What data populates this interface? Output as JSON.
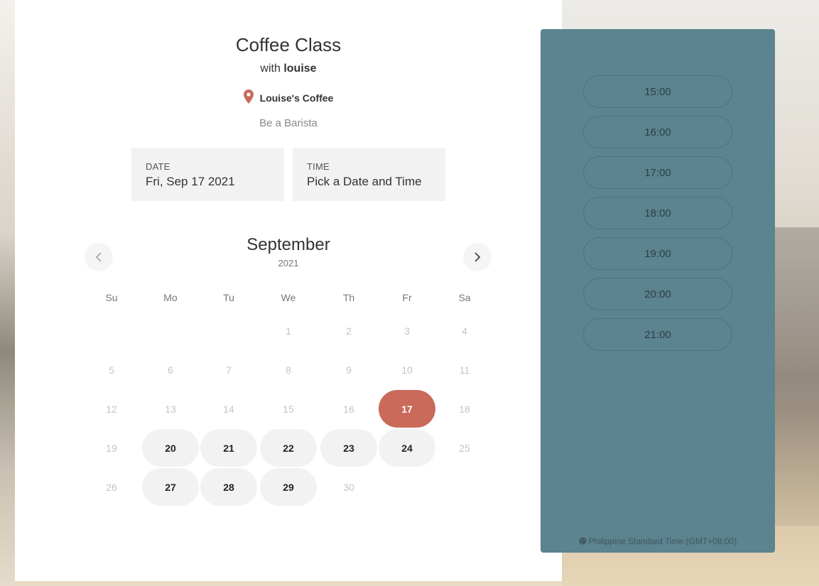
{
  "event": {
    "title": "Coffee Class",
    "with_prefix": "with",
    "host": "louise",
    "location": "Louise's Coffee",
    "description": "Be a Barista"
  },
  "fields": {
    "date_label": "DATE",
    "date_value": "Fri, Sep 17 2021",
    "time_label": "TIME",
    "time_value": "Pick a Date and Time"
  },
  "calendar": {
    "month": "September",
    "year": "2021",
    "weekdays": [
      "Su",
      "Mo",
      "Tu",
      "We",
      "Th",
      "Fr",
      "Sa"
    ],
    "weeks": [
      [
        null,
        null,
        null,
        "1",
        "2",
        "3",
        "4"
      ],
      [
        "5",
        "6",
        "7",
        "8",
        "9",
        "10",
        "11"
      ],
      [
        "12",
        "13",
        "14",
        "15",
        "16",
        "17",
        "18"
      ],
      [
        "19",
        "20",
        "21",
        "22",
        "23",
        "24",
        "25"
      ],
      [
        "26",
        "27",
        "28",
        "29",
        "30",
        null,
        null
      ]
    ],
    "available_days": [
      "20",
      "21",
      "22",
      "23",
      "24",
      "27",
      "28",
      "29"
    ],
    "selected_day": "17"
  },
  "time_slots": [
    "15:00",
    "16:00",
    "17:00",
    "18:00",
    "19:00",
    "20:00",
    "21:00"
  ],
  "timezone": "Philippine Standard Time (GMT+08:00)",
  "colors": {
    "accent": "#c96a5a",
    "panel": "#5b8390",
    "available_bg": "#f2f2f2"
  },
  "icons": {
    "location": "map-pin-icon",
    "prev": "chevron-left-icon",
    "next": "chevron-right-icon",
    "timezone": "globe-icon"
  }
}
